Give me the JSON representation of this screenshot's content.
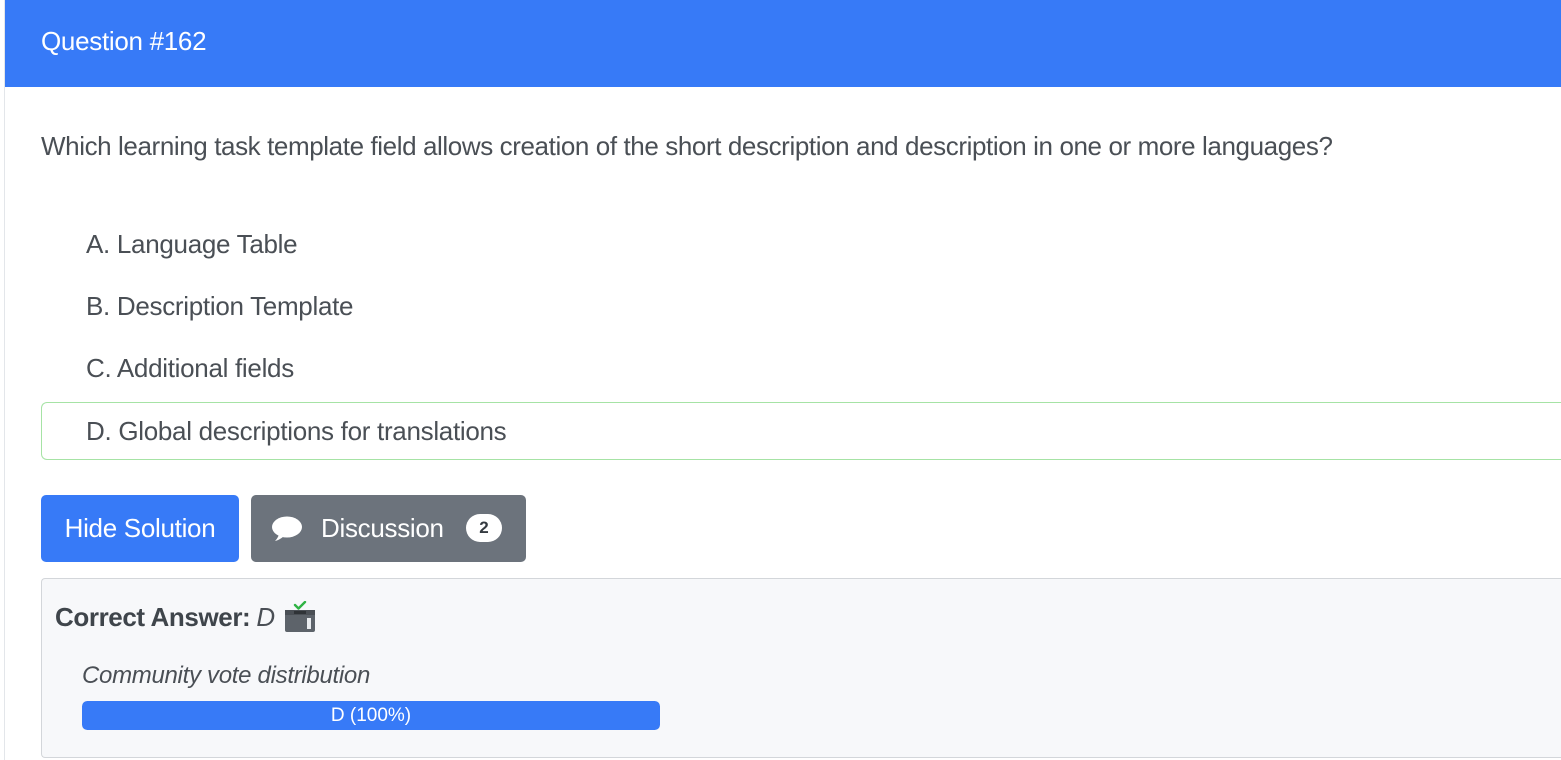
{
  "header": {
    "title": "Question #162",
    "background_color": "#377af7"
  },
  "question": {
    "text": "Which learning task template field allows creation of the short description and description in one or more languages?"
  },
  "choices": [
    {
      "label": "A. Language Table",
      "correct": false
    },
    {
      "label": "B. Description Template",
      "correct": false
    },
    {
      "label": "C. Additional fields",
      "correct": false
    },
    {
      "label": "D. Global descriptions for translations",
      "correct": true
    }
  ],
  "buttons": {
    "hide_solution_label": "Hide Solution",
    "discussion_label": "Discussion",
    "discussion_count": "2",
    "discussion_icon": "chat-bubble-icon"
  },
  "answer": {
    "key_label": "Correct Answer:",
    "value": "D",
    "icon": "vote-box-icon"
  },
  "vote_distribution": {
    "title": "Community vote distribution",
    "bars": [
      {
        "option": "D",
        "percent": 100,
        "label": "D (100%)",
        "color": "#377af7"
      }
    ]
  },
  "colors": {
    "primary": "#377af7",
    "secondary_button": "#6c737c",
    "correct_border": "#a6e3a5",
    "panel_background": "#f7f8fa"
  }
}
